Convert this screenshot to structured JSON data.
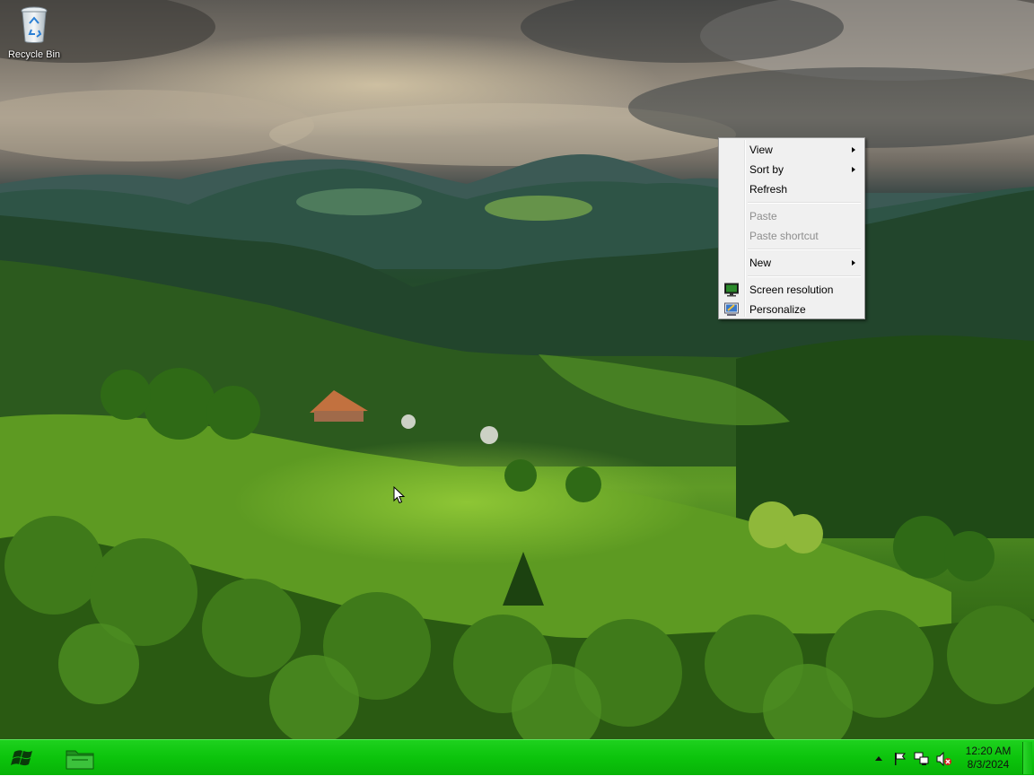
{
  "desktop": {
    "icons": [
      {
        "label": "Recycle Bin",
        "icon": "recycle-bin-icon"
      }
    ]
  },
  "context_menu": {
    "items": [
      {
        "label": "View",
        "submenu": true,
        "enabled": true
      },
      {
        "label": "Sort by",
        "submenu": true,
        "enabled": true
      },
      {
        "label": "Refresh",
        "submenu": false,
        "enabled": true
      },
      {
        "label": "Paste",
        "submenu": false,
        "enabled": false
      },
      {
        "label": "Paste shortcut",
        "submenu": false,
        "enabled": false
      },
      {
        "label": "New",
        "submenu": true,
        "enabled": true
      },
      {
        "label": "Screen resolution",
        "submenu": false,
        "enabled": true,
        "icon": "monitor-icon"
      },
      {
        "label": "Personalize",
        "submenu": false,
        "enabled": true,
        "icon": "personalize-icon"
      }
    ]
  },
  "taskbar": {
    "color": "#0cc40c",
    "start_icon": "windows-logo-icon",
    "pinned": [
      {
        "icon": "folder-icon"
      }
    ],
    "tray": {
      "icons": [
        "show-hidden-icons-icon",
        "action-center-flag-icon",
        "network-icon",
        "volume-muted-icon"
      ],
      "time": "12:20 AM",
      "date": "8/3/2024"
    }
  }
}
